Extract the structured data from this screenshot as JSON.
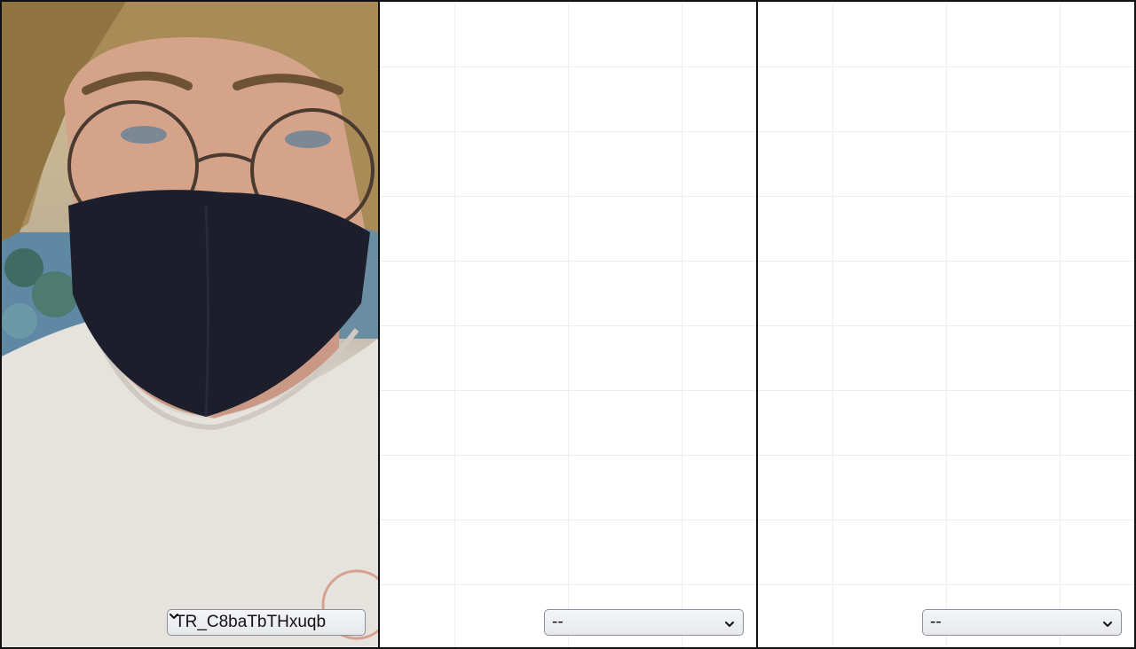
{
  "panels": [
    {
      "kind": "video",
      "select_value": "TR_C8baTbTHxuqb"
    },
    {
      "kind": "empty",
      "select_value": "--"
    },
    {
      "kind": "empty",
      "select_value": "--"
    }
  ],
  "icons": {
    "dropdown": "chevron-down-icon"
  },
  "colors": {
    "border": "#111111",
    "grid_line": "#eceef1"
  }
}
